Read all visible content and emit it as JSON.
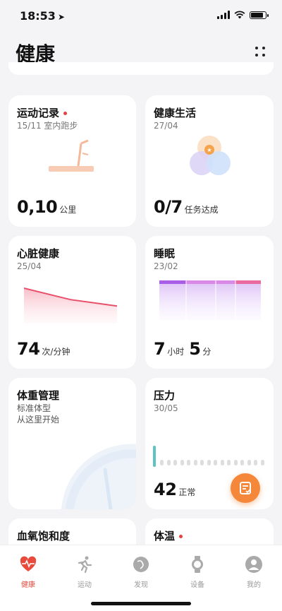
{
  "status": {
    "time": "18:53"
  },
  "header": {
    "title": "健康"
  },
  "cards": {
    "exercise": {
      "title": "运动记录",
      "subtitle": "15/11 室内跑步",
      "value": "0,10",
      "unit": "公里"
    },
    "life": {
      "title": "健康生活",
      "subtitle": "27/04",
      "value": "0/7",
      "unit": "任务达成"
    },
    "heart": {
      "title": "心脏健康",
      "subtitle": "25/04",
      "value": "74",
      "unit": "次/分钟",
      "trend": [
        1.0,
        0.55,
        0.3
      ]
    },
    "sleep": {
      "title": "睡眠",
      "subtitle": "23/02",
      "hours": "7",
      "hours_unit": "小时",
      "minutes": "5",
      "minutes_unit": "分"
    },
    "weight": {
      "title": "体重管理",
      "line1": "标准体型",
      "line2": "从这里开始"
    },
    "stress": {
      "title": "压力",
      "subtitle": "30/05",
      "value": "42",
      "unit": "正常"
    },
    "spo2": {
      "title": "血氧饱和度"
    },
    "temperature": {
      "title": "体温"
    }
  },
  "tabs": [
    {
      "label": "健康",
      "icon": "heart-pulse-icon",
      "active": true
    },
    {
      "label": "运动",
      "icon": "running-icon",
      "active": false
    },
    {
      "label": "发现",
      "icon": "compass-icon",
      "active": false
    },
    {
      "label": "设备",
      "icon": "watch-icon",
      "active": false
    },
    {
      "label": "我的",
      "icon": "profile-icon",
      "active": false
    }
  ],
  "colors": {
    "accent": "#e84a3c",
    "fab": "#f5873a",
    "heart_line": "#e8506a",
    "stress_bar": "#5fc3c3"
  }
}
